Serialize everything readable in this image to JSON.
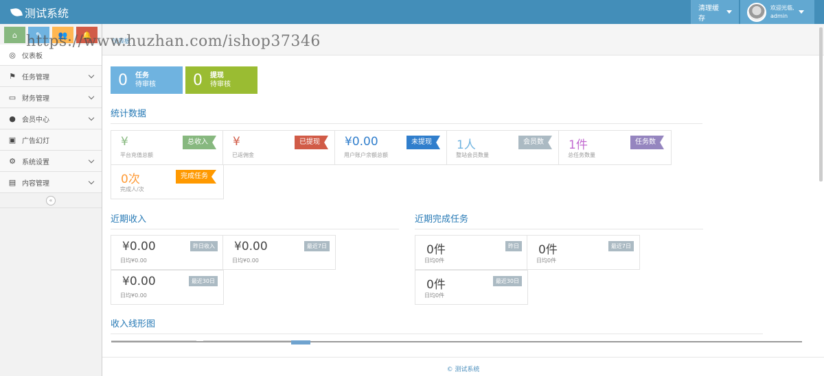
{
  "app": {
    "title": "测试系统"
  },
  "topbar": {
    "clear_cache": "清理缓存",
    "welcome": "欢迎光临,",
    "username": "admin"
  },
  "sidebar": {
    "shortcuts": [
      {
        "icon": "home-icon",
        "glyph": "⌂",
        "color": "#87b87f"
      },
      {
        "icon": "pencil-icon",
        "glyph": "✎",
        "color": "#6fb3e0"
      },
      {
        "icon": "users-icon",
        "glyph": "👥",
        "color": "#ffb752"
      },
      {
        "icon": "bell-icon",
        "glyph": "🔔",
        "color": "#d15b47"
      }
    ],
    "items": [
      {
        "label": "仪表板",
        "icon": "dashboard-icon",
        "glyph": "◎",
        "has_sub": false
      },
      {
        "label": "任务管理",
        "icon": "flag-icon",
        "glyph": "⚑",
        "has_sub": true
      },
      {
        "label": "财务管理",
        "icon": "hdd-icon",
        "glyph": "▭",
        "has_sub": true
      },
      {
        "label": "会员中心",
        "icon": "user-icon",
        "glyph": "●",
        "has_sub": true
      },
      {
        "label": "广告幻灯",
        "icon": "picture-icon",
        "glyph": "▣",
        "has_sub": false
      },
      {
        "label": "系统设置",
        "icon": "cog-icon",
        "glyph": "⚙",
        "has_sub": true
      },
      {
        "label": "内容管理",
        "icon": "book-icon",
        "glyph": "▤",
        "has_sub": true
      }
    ],
    "collapse": "«"
  },
  "breadcrumb": {
    "current": "仪表板"
  },
  "watermark": "https://www.huzhan.com/ishop37346",
  "pending": [
    {
      "count": "0",
      "title": "任务",
      "sub": "待审核",
      "color": "#6fb3e0"
    },
    {
      "count": "0",
      "title": "提现",
      "sub": "待审核",
      "color": "#9abc32"
    }
  ],
  "stats_title": "统计数据",
  "stats": [
    {
      "value": "¥",
      "label": "平台充值总额",
      "flag": "总收入",
      "flag_color": "#87b87f",
      "value_color": "#87b87f"
    },
    {
      "value": "¥",
      "label": "已返佣金",
      "flag": "已提现",
      "flag_color": "#d15b47",
      "value_color": "#d15b47"
    },
    {
      "value": "¥0.00",
      "label": "用户账户余额总额",
      "flag": "未提现",
      "flag_color": "#307ecc",
      "value_color": "#307ecc"
    },
    {
      "value": "1人",
      "label": "整站会员数量",
      "flag": "会员数",
      "flag_color": "#abbac3",
      "value_color": "#6fb3e0"
    },
    {
      "value": "1件",
      "label": "总任务数量",
      "flag": "任务数",
      "flag_color": "#9585bf",
      "value_color": "#c26ad0"
    },
    {
      "value": "0次",
      "label": "完成人/次",
      "flag": "完成任务",
      "flag_color": "#ff9900",
      "value_color": "#ff9933"
    }
  ],
  "income_title": "近期收入",
  "income": [
    {
      "value": "¥0.00",
      "tag": "昨日收入",
      "sub": "日均¥0.00"
    },
    {
      "value": "¥0.00",
      "tag": "最近7日",
      "sub": "日均¥0.00"
    },
    {
      "value": "¥0.00",
      "tag": "最近30日",
      "sub": "日均¥0.00"
    }
  ],
  "tasks_title": "近期完成任务",
  "tasks": [
    {
      "value": "0件",
      "tag": "昨日",
      "sub": "日均0件"
    },
    {
      "value": "0件",
      "tag": "最近7日",
      "sub": "日均0件"
    },
    {
      "value": "0件",
      "tag": "最近30日",
      "sub": "日均0件"
    }
  ],
  "chart_title": "收入线形图",
  "footer": "© 测试系统"
}
